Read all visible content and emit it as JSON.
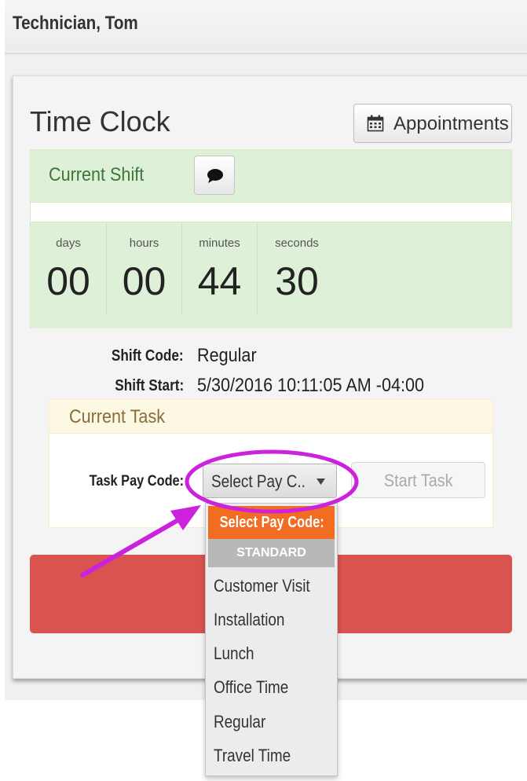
{
  "header": {
    "user_name": "Technician, Tom"
  },
  "page": {
    "title": "Time Clock",
    "appointments_label": "Appointments"
  },
  "shift": {
    "panel_title": "Current Shift",
    "timer": [
      {
        "unit": "days",
        "value": "00"
      },
      {
        "unit": "hours",
        "value": "00"
      },
      {
        "unit": "minutes",
        "value": "44"
      },
      {
        "unit": "seconds",
        "value": "30"
      }
    ],
    "shift_code_label": "Shift Code:",
    "shift_code_value": "Regular",
    "shift_start_label": "Shift Start:",
    "shift_start_value": "5/30/2016 10:11:05 AM -04:00"
  },
  "task": {
    "panel_title": "Current Task",
    "pay_code_label": "Task Pay Code:",
    "pay_code_selected": "Select Pay C..",
    "start_task_label": "Start Task"
  },
  "dropdown": {
    "header": "Select Pay Code:",
    "group_label": "STANDARD",
    "options": [
      "Customer Visit",
      "Installation",
      "Lunch",
      "Office Time",
      "Regular",
      "Travel Time"
    ]
  },
  "colors": {
    "success_bg": "#dff0d8",
    "warning_bg": "#fcf8e3",
    "danger": "#d9534f",
    "dropdown_header": "#f26c21",
    "annotation": "#cc22dd"
  },
  "icons": {
    "appointments": "calendar-icon",
    "comment": "comment-icon",
    "select_caret": "caret-down-icon"
  }
}
